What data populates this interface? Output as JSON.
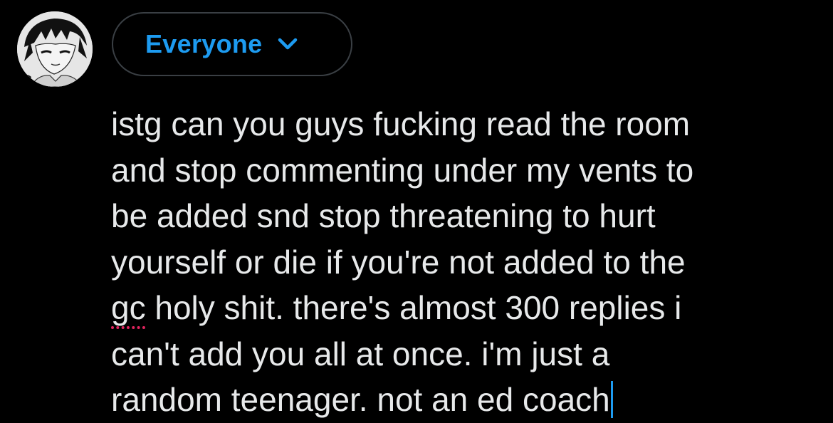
{
  "composer": {
    "audience_label": "Everyone",
    "audience_icon": "chevron-down-icon",
    "accent_color": "#1d9bf0",
    "spellcheck_color": "#e0245e",
    "text": {
      "line1": "istg can you guys fucking read the room",
      "line2": "and stop commenting under my vents to",
      "line3": "be added snd stop threatening to hurt",
      "line4": "yourself or die if you're not added to the",
      "line5_flagged_word": "gc",
      "line5_rest": " holy shit. there's almost 300 replies i",
      "line6": "can't add you all at once. i'm just a",
      "line7": "random teenager. not an ed coach"
    }
  }
}
